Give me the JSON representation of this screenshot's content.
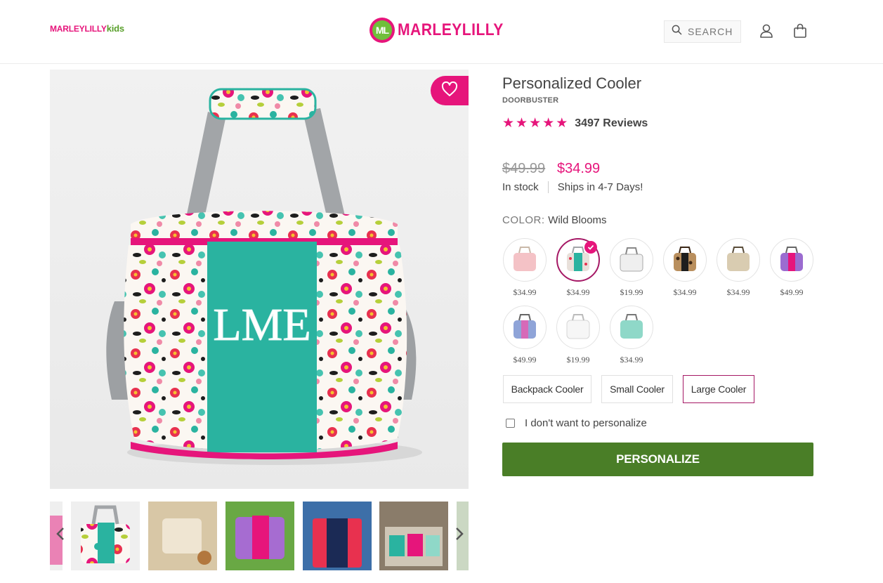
{
  "header": {
    "kids_logo": {
      "brand": "MARLEYLILLY",
      "suffix": "kids"
    },
    "logo": {
      "initials": "ML",
      "brand": "MARLEYLILLY"
    },
    "search": {
      "label": "SEARCH"
    },
    "icons": {
      "search": "search-icon",
      "account": "user-icon",
      "cart": "shopping-bag-icon"
    }
  },
  "gallery": {
    "wishlist_icon": "heart-icon",
    "thumbnails_count": 6
  },
  "product": {
    "title": "Personalized Cooler",
    "badge": "DOORBUSTER",
    "rating": {
      "stars": 5,
      "reviews": "3497 Reviews"
    },
    "price_old": "$49.99",
    "price_new": "$34.99",
    "stock": "In stock",
    "shipping": "Ships in 4-7 Days!",
    "color_label": "COLOR:",
    "color_value": "Wild Blooms",
    "swatches": [
      {
        "price": "$34.99",
        "color": "#f4c2c6"
      },
      {
        "price": "$34.99",
        "color": "#2ab3a0",
        "selected": true
      },
      {
        "price": "$19.99",
        "color": "#e6e6e6"
      },
      {
        "price": "$34.99",
        "color": "#6b4a2e"
      },
      {
        "price": "$34.99",
        "color": "#d9ccb1"
      },
      {
        "price": "$49.99",
        "color": "#9b6cd0"
      },
      {
        "price": "$49.99",
        "color": "#d66ab8"
      },
      {
        "price": "$19.99",
        "color": "#f2f2f2"
      },
      {
        "price": "$34.99",
        "color": "#8fd8c8"
      }
    ],
    "sizes": [
      {
        "label": "Backpack Cooler"
      },
      {
        "label": "Small Cooler"
      },
      {
        "label": "Large Cooler",
        "active": true
      }
    ],
    "no_personalize": "I don't want to personalize",
    "cta": "PERSONALIZE"
  },
  "colors": {
    "brand_pink": "#e6157b",
    "cta_green": "#4a7e27",
    "teal": "#2ab3a0"
  }
}
